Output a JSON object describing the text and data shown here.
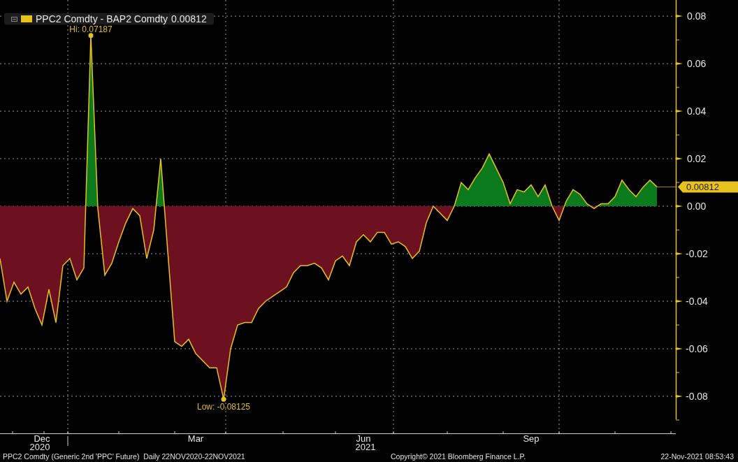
{
  "legend": {
    "value": "0.00812",
    "color": "#e8c21c"
  },
  "chart_data": {
    "type": "line",
    "grid": true,
    "categories": [
      null,
      null,
      null,
      null,
      null,
      null,
      "Dec",
      null,
      null,
      null,
      null,
      null,
      null,
      null,
      null,
      null,
      null,
      null,
      null,
      null,
      null,
      null,
      null,
      null,
      null,
      null,
      null,
      null,
      "Mar",
      null,
      null,
      null,
      null,
      null,
      null,
      null,
      null,
      null,
      null,
      null,
      null,
      null,
      null,
      null,
      null,
      null,
      null,
      null,
      null,
      null,
      null,
      null,
      "Jun",
      null,
      null,
      null,
      null,
      null,
      null,
      null,
      null,
      null,
      null,
      null,
      null,
      null,
      null,
      null,
      null,
      null,
      null,
      null,
      null,
      null,
      null,
      null,
      "Sep",
      null,
      null,
      null,
      null,
      null,
      null,
      null,
      null,
      null,
      null,
      null,
      null,
      null,
      null,
      null,
      null,
      null,
      null
    ],
    "series": [
      {
        "name": "PPC2 Comdty - BAP2 Comdty",
        "color": "#e8c21c",
        "values": [
          -0.022,
          -0.04,
          -0.032,
          -0.037,
          -0.034,
          -0.043,
          -0.05,
          -0.035,
          -0.049,
          -0.025,
          -0.022,
          -0.031,
          -0.026,
          0.07187,
          -0.001,
          -0.029,
          -0.024,
          -0.015,
          -0.007,
          -0.001,
          -0.004,
          -0.022,
          -0.01,
          0.02,
          -0.019,
          -0.057,
          -0.059,
          -0.056,
          -0.062,
          -0.065,
          -0.068,
          -0.068,
          -0.08125,
          -0.06,
          -0.05,
          -0.049,
          -0.049,
          -0.043,
          -0.04,
          -0.038,
          -0.036,
          -0.034,
          -0.028,
          -0.025,
          -0.025,
          -0.024,
          -0.026,
          -0.031,
          -0.023,
          -0.021,
          -0.025,
          -0.015,
          -0.012,
          -0.015,
          -0.011,
          -0.011,
          -0.016,
          -0.015,
          -0.017,
          -0.022,
          -0.019,
          -0.007,
          0,
          -0.003,
          -0.006,
          0,
          0.01,
          0.007,
          0.012,
          0.016,
          0.022,
          0.016,
          0.01,
          0.001,
          0.007,
          0.006,
          0.009,
          0.004,
          0.009,
          0,
          -0.006,
          0.002,
          0.007,
          0.005,
          0.001,
          -0.001,
          0.001,
          0.001,
          0.004,
          0.011,
          0.007,
          0.004,
          0.008,
          0.011,
          0.00812
        ]
      }
    ],
    "ylim": [
      -0.0956,
      0.0868
    ],
    "yticks": [
      {
        "value": 0.08,
        "label": "0.08"
      },
      {
        "value": 0.06,
        "label": "0.06"
      },
      {
        "value": 0.04,
        "label": "0.04"
      },
      {
        "value": 0.02,
        "label": "0.02"
      },
      {
        "value": 0,
        "label": "0.00"
      },
      {
        "value": -0.02,
        "label": "-0.02"
      },
      {
        "value": -0.04,
        "label": "-0.04"
      },
      {
        "value": -0.06,
        "label": "-0.06"
      },
      {
        "value": -0.08,
        "label": "-0.08"
      }
    ]
  },
  "extreme_labels": [
    {
      "text": "Hi: 0.07187"
    },
    {
      "text": "Low: -0.08125"
    }
  ],
  "year_labels": [
    "2020",
    "2021"
  ],
  "last_value_tag": {
    "label": "0.00812"
  },
  "footer": {
    "description": "PPC2 Comdty (Generic 2nd 'PPC' Future)  Daily 22NOV2020-22NOV2021",
    "copyright": "Copyright© 2021 Bloomberg Finance L.P.",
    "timestamp": "22-Nov-2021 08:53:43"
  }
}
